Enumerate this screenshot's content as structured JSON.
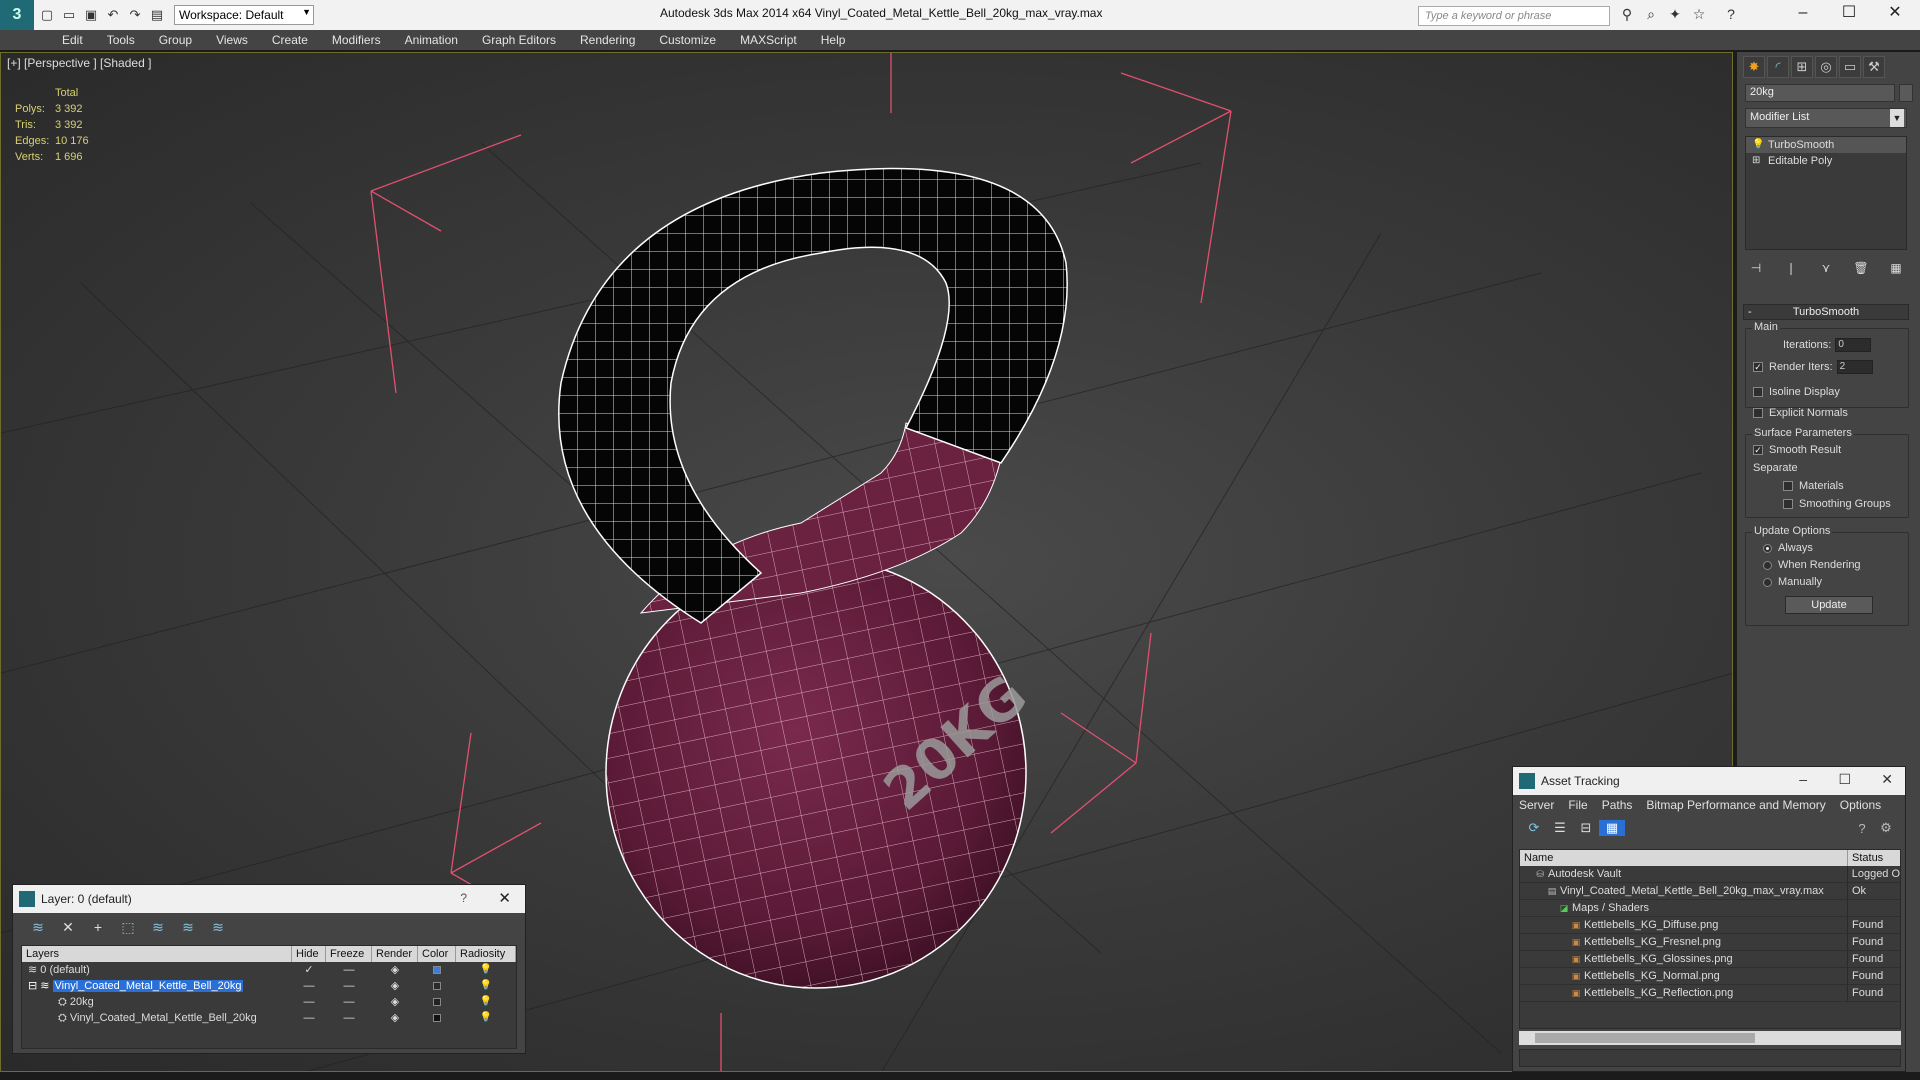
{
  "titlebar": {
    "workspace": "Workspace: Default",
    "title": "Autodesk 3ds Max  2014 x64      Vinyl_Coated_Metal_Kettle_Bell_20kg_max_vray.max",
    "search_placeholder": "Type a keyword or phrase"
  },
  "menu": [
    "Edit",
    "Tools",
    "Group",
    "Views",
    "Create",
    "Modifiers",
    "Animation",
    "Graph Editors",
    "Rendering",
    "Customize",
    "MAXScript",
    "Help"
  ],
  "viewport": {
    "label": "[+] [Perspective ] [Shaded ]",
    "stats": {
      "header": "Total",
      "polys_label": "Polys:",
      "polys": "3 392",
      "tris_label": "Tris:",
      "tris": "3 392",
      "edges_label": "Edges:",
      "edges": "10 176",
      "verts_label": "Verts:",
      "verts": "1 696"
    },
    "model_text": "20KG"
  },
  "command_panel": {
    "object_name": "20kg",
    "modifier_list": "Modifier List",
    "stack": [
      "TurboSmooth",
      "Editable Poly"
    ],
    "rollout": "TurboSmooth",
    "main_group": "Main",
    "iterations_label": "Iterations:",
    "iterations": "0",
    "render_iters_label": "Render Iters:",
    "render_iters": "2",
    "isoline": "Isoline Display",
    "explicit_normals": "Explicit Normals",
    "surface_group": "Surface Parameters",
    "smooth_result": "Smooth Result",
    "separate": "Separate",
    "materials": "Materials",
    "smoothing_groups": "Smoothing Groups",
    "update_group": "Update Options",
    "always": "Always",
    "when_rendering": "When Rendering",
    "manually": "Manually",
    "update_btn": "Update"
  },
  "layer_dialog": {
    "title": "Layer: 0 (default)",
    "help": "?",
    "columns": [
      "Layers",
      "Hide",
      "Freeze",
      "Render",
      "Color",
      "Radiosity"
    ],
    "rows": [
      {
        "name": "0 (default)",
        "color": "#3a7fd6"
      },
      {
        "name": "Vinyl_Coated_Metal_Kettle_Bell_20kg",
        "color": "#2a2a2a"
      },
      {
        "name": "20kg",
        "color": "#222222"
      },
      {
        "name": "Vinyl_Coated_Metal_Kettle_Bell_20kg",
        "color": "#111111"
      }
    ]
  },
  "asset_dialog": {
    "title": "Asset Tracking",
    "menu": [
      "Server",
      "File",
      "Paths",
      "Bitmap Performance and Memory",
      "Options"
    ],
    "columns": [
      "Name",
      "Status"
    ],
    "rows": [
      {
        "name": "Autodesk Vault",
        "status": "Logged O"
      },
      {
        "name": "Vinyl_Coated_Metal_Kettle_Bell_20kg_max_vray.max",
        "status": "Ok"
      },
      {
        "name": "Maps / Shaders",
        "status": ""
      },
      {
        "name": "Kettlebells_KG_Diffuse.png",
        "status": "Found"
      },
      {
        "name": "Kettlebells_KG_Fresnel.png",
        "status": "Found"
      },
      {
        "name": "Kettlebells_KG_Glossines.png",
        "status": "Found"
      },
      {
        "name": "Kettlebells_KG_Normal.png",
        "status": "Found"
      },
      {
        "name": "Kettlebells_KG_Reflection.png",
        "status": "Found"
      }
    ]
  }
}
